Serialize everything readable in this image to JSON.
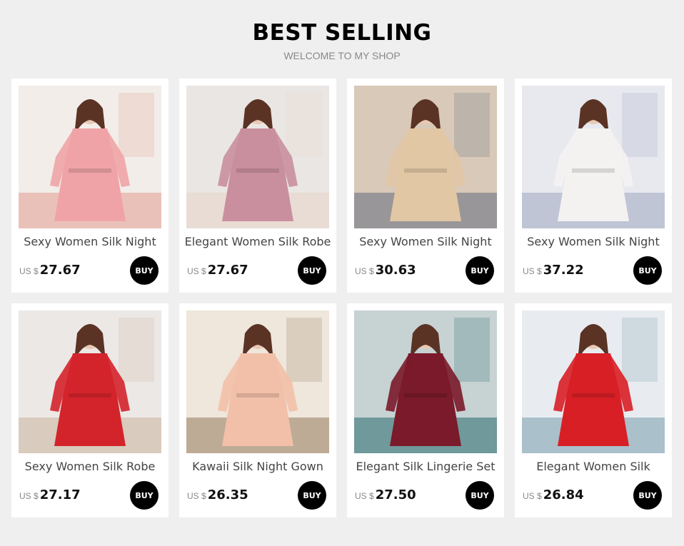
{
  "header": {
    "title": "BEST SELLING",
    "subtitle": "WELCOME TO MY SHOP"
  },
  "products": [
    {
      "name": "Sexy Women Silk Night",
      "currency": "US $",
      "price": "27.67",
      "buy_label": "BUY",
      "bg": "#f2ede9",
      "garment": "#f0a3a6",
      "accent": "#e9b9b0"
    },
    {
      "name": "Elegant Women Silk Robe",
      "currency": "US $",
      "price": "27.67",
      "buy_label": "BUY",
      "bg": "#eae6e3",
      "garment": "#c98f9e",
      "accent": "#e7d9d1"
    },
    {
      "name": "Sexy Women Silk Night",
      "currency": "US $",
      "price": "30.63",
      "buy_label": "BUY",
      "bg": "#d8c9b8",
      "garment": "#e2c7a5",
      "accent": "#8d8d92"
    },
    {
      "name": "Sexy Women Silk Night",
      "currency": "US $",
      "price": "37.22",
      "buy_label": "BUY",
      "bg": "#e7e9ef",
      "garment": "#f4f2f1",
      "accent": "#b9bed0"
    },
    {
      "name": "Sexy Women Silk Robe",
      "currency": "US $",
      "price": "27.17",
      "buy_label": "BUY",
      "bg": "#ece8e6",
      "garment": "#d4242b",
      "accent": "#d6c6b5"
    },
    {
      "name": "Kawaii Silk Night Gown",
      "currency": "US $",
      "price": "26.35",
      "buy_label": "BUY",
      "bg": "#efe6dc",
      "garment": "#f2c0a9",
      "accent": "#b5a089"
    },
    {
      "name": "Elegant Silk Lingerie Set",
      "currency": "US $",
      "price": "27.50",
      "buy_label": "BUY",
      "bg": "#c7d2d3",
      "garment": "#7a1a2a",
      "accent": "#5f8f91"
    },
    {
      "name": "Elegant Women Silk",
      "currency": "US $",
      "price": "26.84",
      "buy_label": "BUY",
      "bg": "#e8ecf0",
      "garment": "#d81f26",
      "accent": "#9fb8c4"
    }
  ]
}
